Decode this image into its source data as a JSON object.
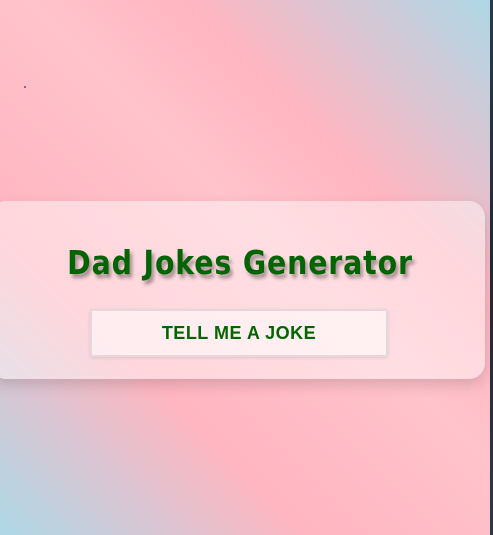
{
  "app": {
    "title": "Dad Jokes Generator"
  },
  "actions": {
    "tell_joke_label": "TELL ME A JOKE"
  },
  "colors": {
    "title_text": "#006400",
    "background_pink": "#ffb6c1",
    "background_blue": "#add8e6"
  }
}
